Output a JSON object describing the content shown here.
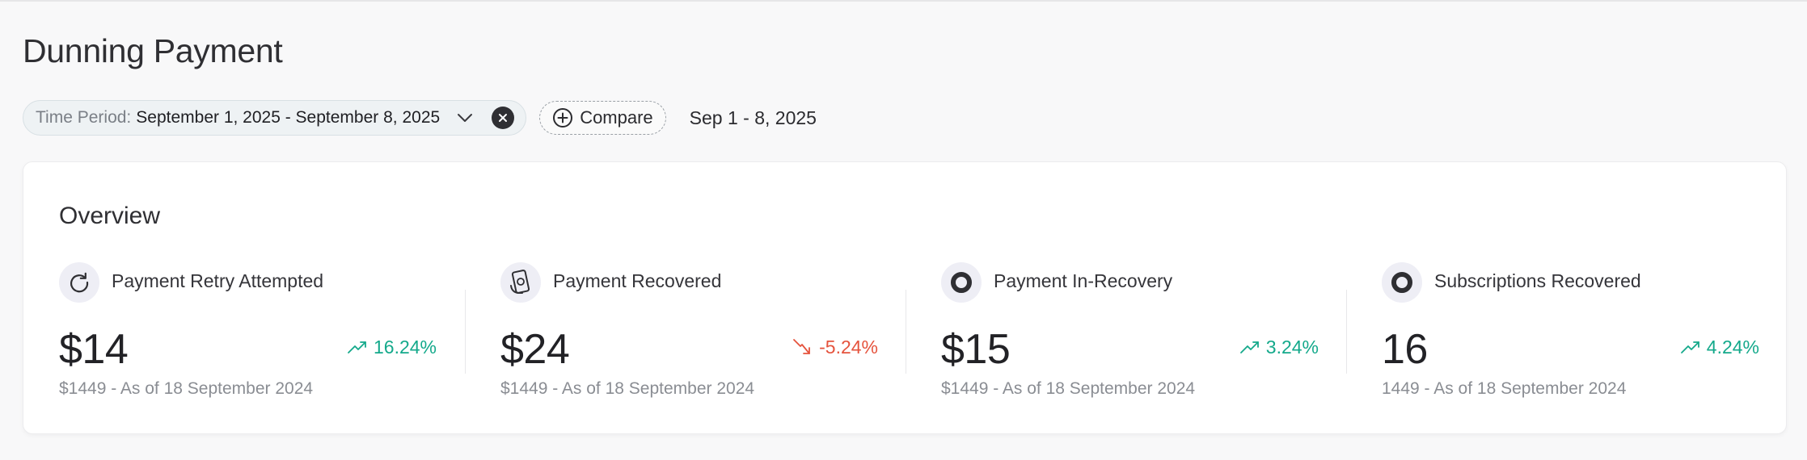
{
  "page": {
    "title": "Dunning Payment"
  },
  "filters": {
    "period_label": "Time Period:",
    "period_value": "September 1, 2025 - September 8, 2025",
    "compare_label": "Compare",
    "date_summary": "Sep 1 - 8, 2025"
  },
  "overview": {
    "title": "Overview",
    "metrics": [
      {
        "icon": "refresh-icon",
        "label": "Payment Retry Attempted",
        "value": "$14",
        "change": "16.24%",
        "trend": "up",
        "sub": "$1449 - As of 18 September 2024"
      },
      {
        "icon": "payment-recovered-icon",
        "label": "Payment Recovered",
        "value": "$24",
        "change": "-5.24%",
        "trend": "down",
        "sub": "$1449 - As of 18 September 2024"
      },
      {
        "icon": "ring-icon",
        "label": "Payment In-Recovery",
        "value": "$15",
        "change": "3.24%",
        "trend": "up",
        "sub": "$1449 - As of 18 September 2024"
      },
      {
        "icon": "ring-icon",
        "label": "Subscriptions Recovered",
        "value": "16",
        "change": "4.24%",
        "trend": "up",
        "sub": "1449 - As of 18 September 2024"
      }
    ]
  },
  "colors": {
    "positive": "#14a98b",
    "negative": "#e5533d",
    "icon_bg": "#eeeef5",
    "chip_bg": "#eef2f4"
  }
}
